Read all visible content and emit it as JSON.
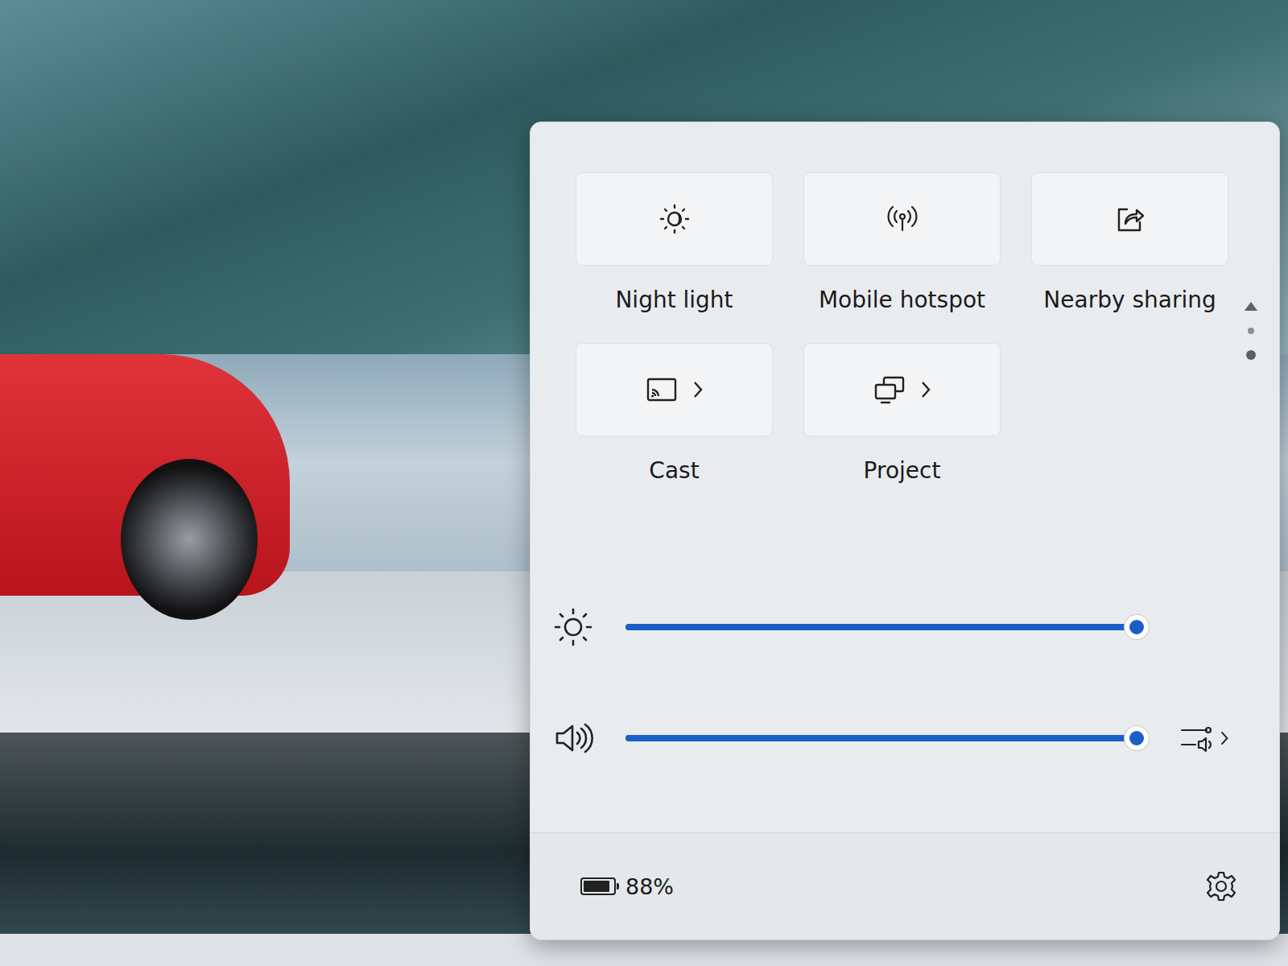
{
  "quick_settings": {
    "tiles": [
      {
        "label": "Night light",
        "on": false,
        "expandable": false
      },
      {
        "label": "Mobile hotspot",
        "on": false,
        "expandable": false
      },
      {
        "label": "Nearby sharing",
        "on": false,
        "expandable": false
      },
      {
        "label": "Cast",
        "on": false,
        "expandable": true
      },
      {
        "label": "Project",
        "on": false,
        "expandable": true
      }
    ],
    "pages": [
      {
        "selected": false
      },
      {
        "selected": true
      }
    ],
    "sliders": [
      {
        "kind": "brightness",
        "level": 0.98
      },
      {
        "kind": "volume",
        "level": 0.98
      }
    ],
    "battery": {
      "percent": "88%",
      "level": 0.88
    }
  }
}
